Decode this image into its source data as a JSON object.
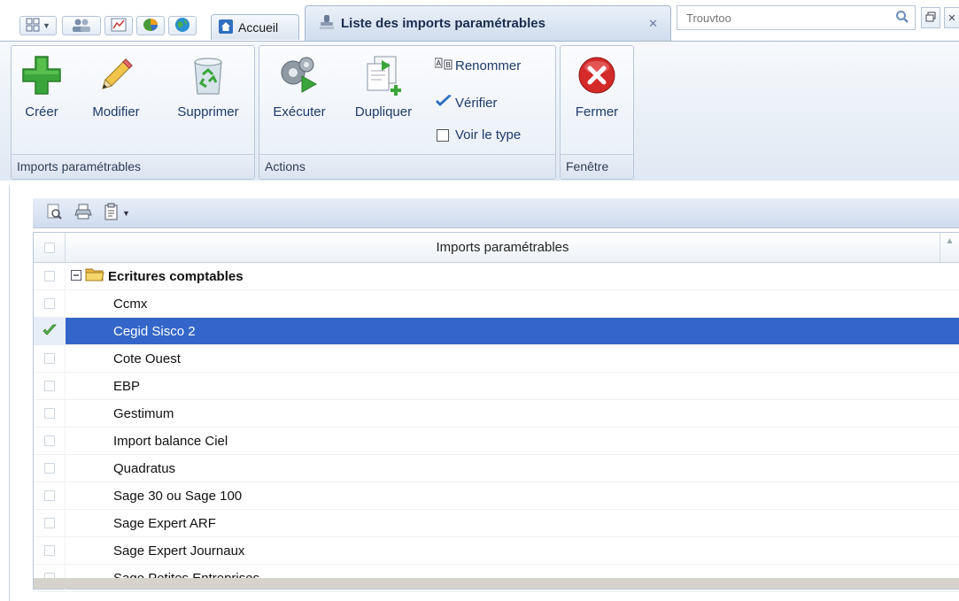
{
  "tabs": {
    "home_label": "Accueil",
    "active_label": "Liste des imports paramétrables"
  },
  "search": {
    "placeholder": "Trouvtoo"
  },
  "ribbon": {
    "groups": [
      {
        "label": "Imports paramétrables"
      },
      {
        "label": "Actions"
      },
      {
        "label": "Fenêtre"
      }
    ],
    "create": "Créer",
    "edit": "Modifier",
    "delete": "Supprimer",
    "execute": "Exécuter",
    "duplicate": "Dupliquer",
    "rename": "Renommer",
    "verify": "Vérifier",
    "show_type": "Voir le type",
    "close": "Fermer"
  },
  "grid": {
    "column_title": "Imports paramétrables",
    "group": "Ecritures comptables",
    "rows": [
      {
        "label": "Ccmx",
        "checked": false
      },
      {
        "label": "Cegid Sisco 2",
        "checked": true
      },
      {
        "label": "Cote Ouest",
        "checked": false
      },
      {
        "label": "EBP",
        "checked": false
      },
      {
        "label": "Gestimum",
        "checked": false
      },
      {
        "label": "Import balance Ciel",
        "checked": false
      },
      {
        "label": "Quadratus",
        "checked": false
      },
      {
        "label": "Sage 30 ou Sage 100",
        "checked": false
      },
      {
        "label": "Sage Expert ARF",
        "checked": false
      },
      {
        "label": "Sage Expert Journaux",
        "checked": false
      },
      {
        "label": "Sage Petites Entreprises",
        "checked": false
      }
    ],
    "selected_row": "Cegid Sisco 2"
  },
  "colors": {
    "selection": "#3366c8",
    "ribbon_text": "#1d3a6a",
    "create_green": "#3aa53a",
    "close_red": "#d42a2a"
  },
  "icons": [
    "apps-grid-icon",
    "people-icon",
    "spreadsheet-icon",
    "pie-chart-icon",
    "globe-icon",
    "home-icon",
    "stamp-icon",
    "close-icon",
    "search-icon",
    "restore-window-icon",
    "plus-icon",
    "pencil-icon",
    "recycle-bin-icon",
    "gears-play-icon",
    "duplicate-doc-icon",
    "rename-icon",
    "checkmark-icon",
    "close-circle-icon",
    "preview-icon",
    "print-icon",
    "clipboard-icon",
    "folder-icon",
    "collapse-icon",
    "check-icon"
  ]
}
